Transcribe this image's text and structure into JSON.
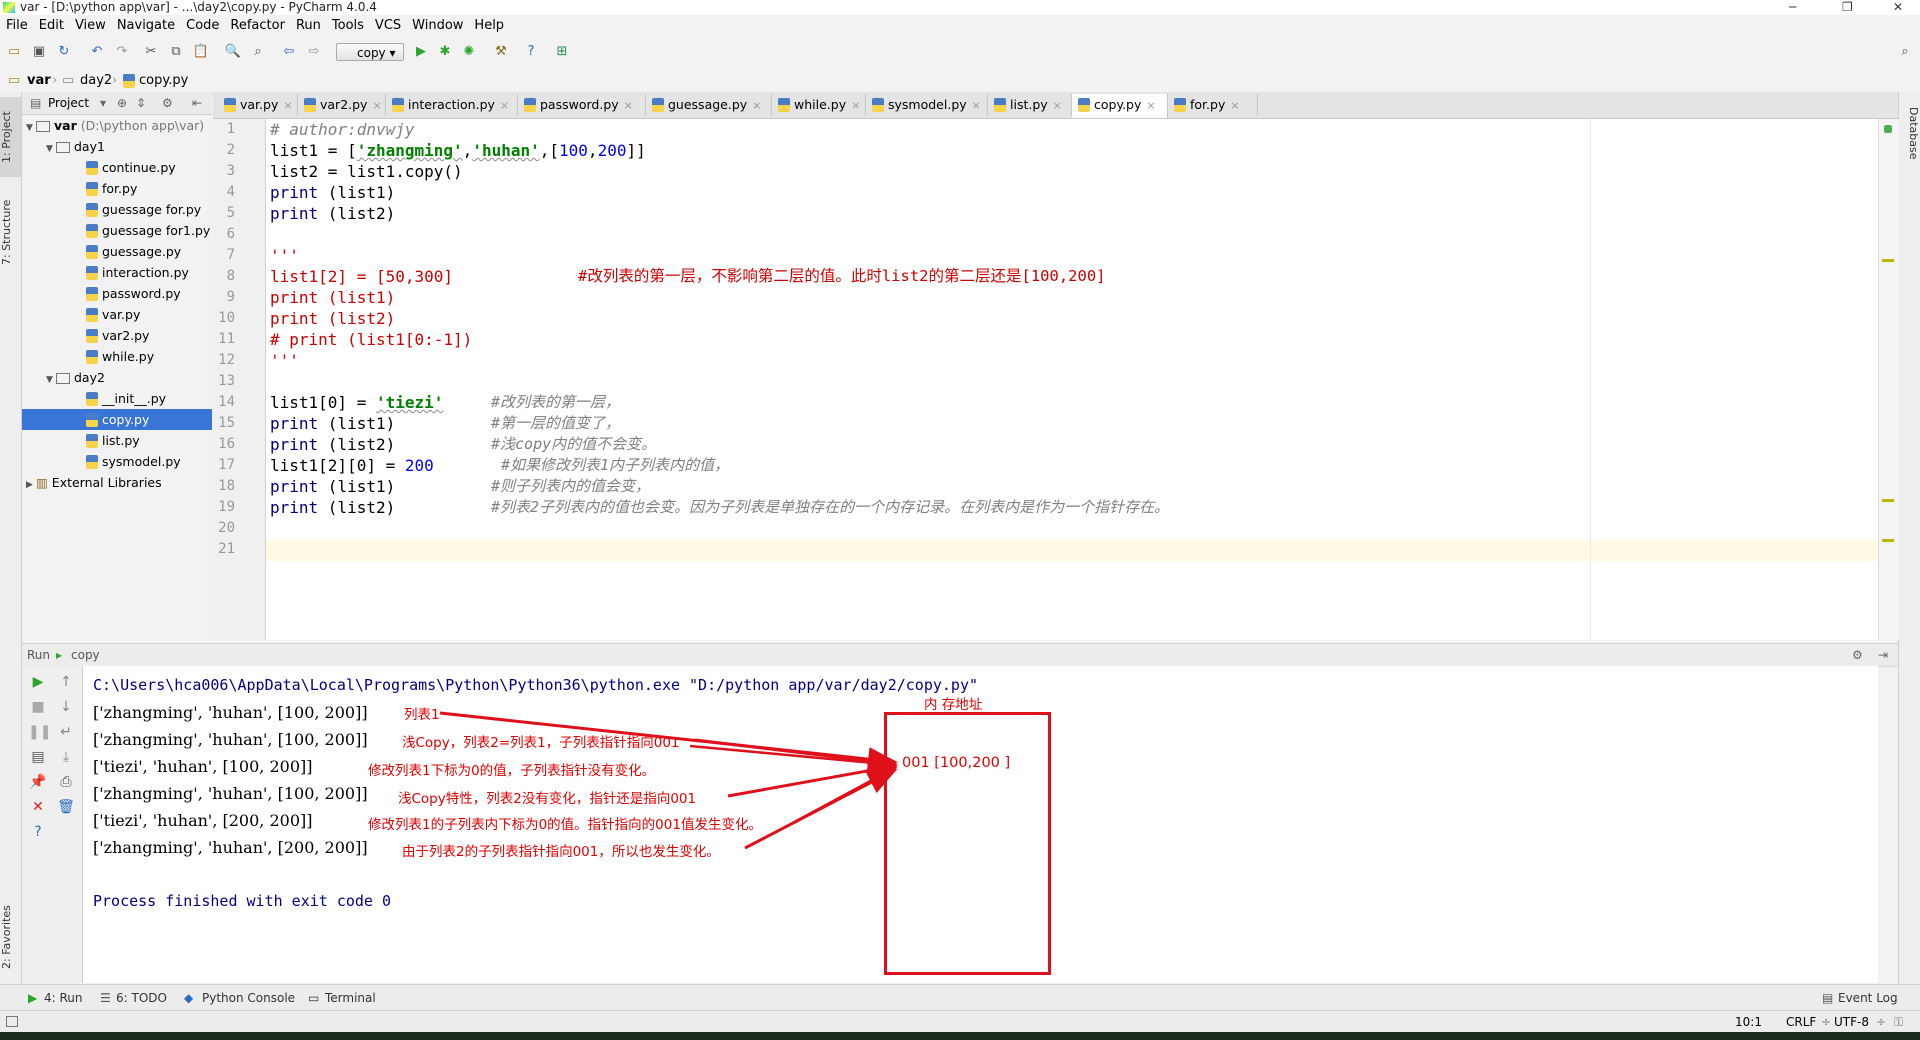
{
  "window": {
    "title": "var - [D:\\python app\\var] - ...\\day2\\copy.py - PyCharm 4.0.4",
    "minimize": "─",
    "maximize": "❐",
    "close": "✕"
  },
  "menu": [
    "File",
    "Edit",
    "View",
    "Navigate",
    "Code",
    "Refactor",
    "Run",
    "Tools",
    "VCS",
    "Window",
    "Help"
  ],
  "toolbar": {
    "run_config": "copy"
  },
  "breadcrumb": [
    "var",
    "day2",
    "copy.py"
  ],
  "left_strip": {
    "project": "1: Project",
    "structure": "7: Structure",
    "favorites": "2: Favorites"
  },
  "right_strip": {
    "database": "Database"
  },
  "project_panel": {
    "header": "Project",
    "root": {
      "name": "var",
      "path": "(D:\\python app\\var)"
    },
    "day1": {
      "name": "day1",
      "files": [
        "continue.py",
        "for.py",
        "guessage for.py",
        "guessage for1.py",
        "guessage.py",
        "interaction.py",
        "password.py",
        "var.py",
        "var2.py",
        "while.py"
      ]
    },
    "day2": {
      "name": "day2",
      "files": [
        "__init__.py",
        "copy.py",
        "list.py",
        "sysmodel.py"
      ]
    },
    "external": "External Libraries"
  },
  "tabs": [
    "var.py",
    "var2.py",
    "interaction.py",
    "password.py",
    "guessage.py",
    "while.py",
    "sysmodel.py",
    "list.py",
    "copy.py",
    "for.py"
  ],
  "active_tab": "copy.py",
  "code": {
    "line_numbers": [
      "1",
      "2",
      "3",
      "4",
      "5",
      "6",
      "7",
      "8",
      "9",
      "10",
      "11",
      "12",
      "13",
      "14",
      "15",
      "16",
      "17",
      "18",
      "19",
      "20",
      "21"
    ],
    "l1": "# author:dnvwjy",
    "l2a": "list1 = [",
    "l2b": "'zhangming'",
    "l2c": ",",
    "l2d": "'huhan'",
    "l2e": ",[",
    "l2f": "100",
    "l2g": ",",
    "l2h": "200",
    "l2i": "]]",
    "l3": "list2 = list1.copy()",
    "l4a": "print",
    "l4b": " (list1)",
    "l5a": "print",
    "l5b": " (list2)",
    "l7": "'''",
    "l8a": "list1[2] = [50,300]",
    "l8b": "#改列表的第一层，不影响第二层的值。此时list2的第二层还是[100,200]",
    "l9": "print (list1)",
    "l10": "print (list2)",
    "l11": "# print (list1[0:-1])",
    "l12": "'''",
    "l14a": "list1[0] = ",
    "l14b": "'tiezi'",
    "l14c": "#改列表的第一层，",
    "l15a": "print",
    "l15b": " (list1)",
    "l15c": "#第一层的值变了，",
    "l16a": "print",
    "l16b": " (list2)",
    "l16c": "#浅copy内的值不会变。",
    "l17a": "list1[2][0] = ",
    "l17b": "200",
    "l17c": "#如果修改列表1内子列表内的值，",
    "l18a": "print",
    "l18b": " (list1)",
    "l18c": "#则子列表内的值会变，",
    "l19a": "print",
    "l19b": " (list2)",
    "l19c": "#列表2子列表内的值也会变。因为子列表是单独存在的一个内存记录。在列表内是作为一个指针存在。"
  },
  "run_panel": {
    "header_label": "Run",
    "config": "copy",
    "command": "C:\\Users\\hca006\\AppData\\Local\\Programs\\Python\\Python36\\python.exe \"D:/python app/var/day2/copy.py\"",
    "output": [
      "['zhangming', 'huhan', [100, 200]]",
      "['zhangming', 'huhan', [100, 200]]",
      "['tiezi', 'huhan', [100, 200]]",
      "['zhangming', 'huhan', [100, 200]]",
      "['tiezi', 'huhan', [200, 200]]",
      "['zhangming', 'huhan', [200, 200]]"
    ],
    "finished": "Process finished with exit code 0"
  },
  "annotations": {
    "a1": "列表1",
    "a2": "浅Copy，列表2=列表1，子列表指针指向001",
    "a3": "修改列表1下标为0的值，子列表指针没有变化。",
    "a4": "浅Copy特性，列表2没有变化，指针还是指向001",
    "a5": "修改列表1的子列表内下标为0的值。指针指向的001值发生变化。",
    "a6": "由于列表2的子列表指针指向001，所以也发生变化。",
    "memory_title": "内 存地址",
    "memory_value": "001 [100,200 ]",
    "accent": "#e0101a"
  },
  "bottom_tabs": {
    "run": "4: Run",
    "todo": "6: TODO",
    "python_console": "Python Console",
    "terminal": "Terminal",
    "event_log": "Event Log"
  },
  "status": {
    "position": "10:1",
    "line_sep": "CRLF",
    "encoding": "UTF-8"
  }
}
